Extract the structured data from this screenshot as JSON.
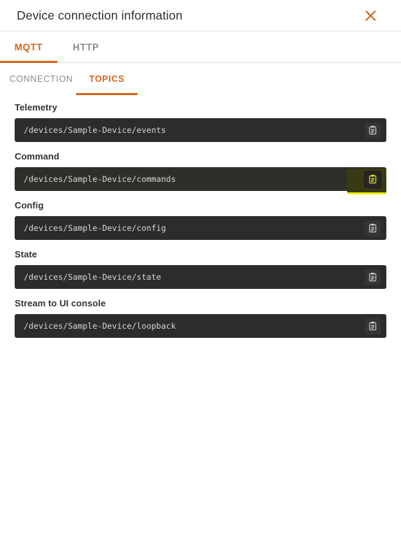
{
  "dialog": {
    "title": "Device connection information",
    "close_icon": "close-icon"
  },
  "primary_tabs": [
    {
      "label": "MQTT",
      "active": true
    },
    {
      "label": "HTTP",
      "active": false
    }
  ],
  "secondary_tabs": [
    {
      "label": "CONNECTION",
      "active": false
    },
    {
      "label": "TOPICS",
      "active": true
    }
  ],
  "topics": [
    {
      "label": "Telemetry",
      "value": "/devices/Sample-Device/events",
      "copy_icon": "copy-icon",
      "highlighted": false
    },
    {
      "label": "Command",
      "value": "/devices/Sample-Device/commands",
      "copy_icon": "copy-icon",
      "highlighted": true
    },
    {
      "label": "Config",
      "value": "/devices/Sample-Device/config",
      "copy_icon": "copy-icon",
      "highlighted": false
    },
    {
      "label": "State",
      "value": "/devices/Sample-Device/state",
      "copy_icon": "copy-icon",
      "highlighted": false
    },
    {
      "label": "Stream to UI console",
      "value": "/devices/Sample-Device/loopback",
      "copy_icon": "copy-icon",
      "highlighted": false
    }
  ],
  "colors": {
    "accent": "#d2661c",
    "field_background": "#2c2c2c",
    "field_text": "#d8d8d8",
    "highlight": "#e8e80a",
    "title_text": "#2f2f2f",
    "inactive_tab": "#8a8a8a"
  }
}
